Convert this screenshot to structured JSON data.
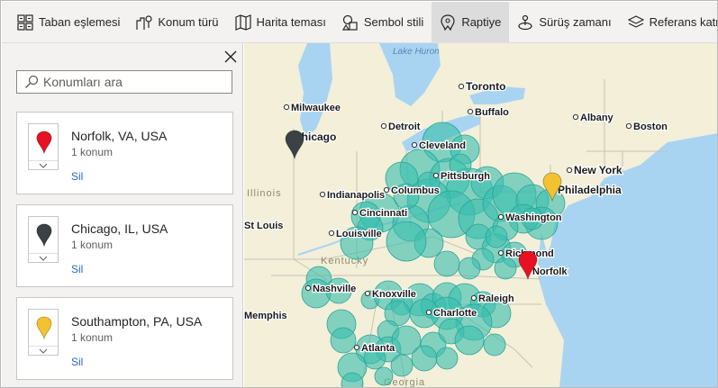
{
  "toolbar": {
    "items": [
      {
        "label": "Taban eşlemesi",
        "icon": "basemap-grid-icon"
      },
      {
        "label": "Konum türü",
        "icon": "location-type-icon"
      },
      {
        "label": "Harita teması",
        "icon": "map-theme-icon"
      },
      {
        "label": "Sembol stili",
        "icon": "symbol-style-icon"
      },
      {
        "label": "Raptiye",
        "icon": "pin-icon",
        "active": true
      },
      {
        "label": "Sürüş zamanı",
        "icon": "drive-time-icon"
      },
      {
        "label": "Referans katmanı",
        "icon": "reference-layer-icon"
      }
    ]
  },
  "panel": {
    "search": {
      "placeholder": "Konumları ara",
      "value": ""
    },
    "locations": [
      {
        "title": "Norfolk, VA, USA",
        "count": "1 konum",
        "remove": "Sil",
        "pin_color": "#e81123"
      },
      {
        "title": "Chicago, IL, USA",
        "count": "1 konum",
        "remove": "Sil",
        "pin_color": "#3b4144"
      },
      {
        "title": "Southampton, PA, USA",
        "count": "1 konum",
        "remove": "Sil",
        "pin_color": "#f2c230"
      }
    ]
  },
  "map": {
    "water_labels": [
      "Lake Huron"
    ],
    "state_labels": [
      "Illinois",
      "Kentucky",
      "Georgia"
    ],
    "cities": [
      "Toronto",
      "Milwaukee",
      "Buffalo",
      "Albany",
      "Boston",
      "Detroit",
      "Chicago",
      "Cleveland",
      "New York",
      "Pittsburgh",
      "Philadelphia",
      "Indianapolis",
      "Columbus",
      "Cincinnati",
      "Washington",
      "St Louis",
      "Louisville",
      "Richmond",
      "Norfolk",
      "Nashville",
      "Knoxville",
      "Raleigh",
      "Memphis",
      "Charlotte",
      "Atlanta"
    ],
    "bubble_color": "#3cbfae",
    "land_color": "#f3efd9",
    "water_color": "#a8d4f1"
  }
}
